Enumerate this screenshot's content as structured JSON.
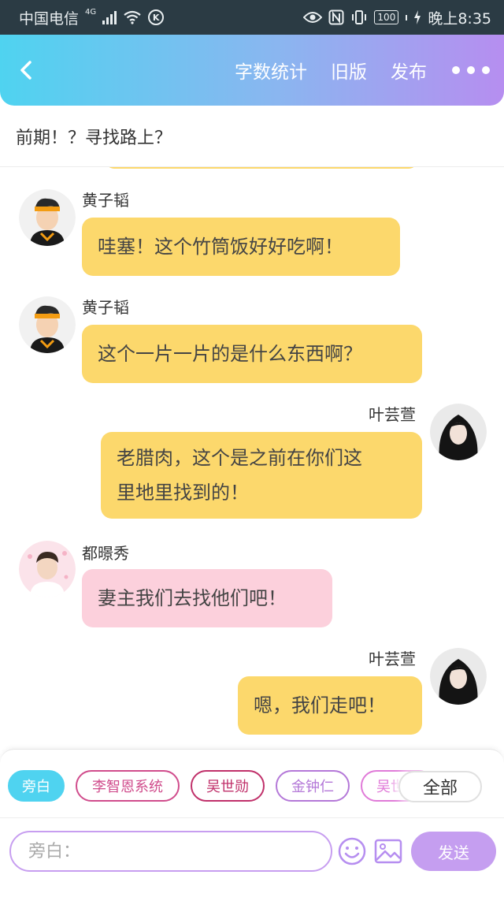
{
  "status_bar": {
    "carrier": "中国电信",
    "network_type": "4G",
    "battery_level": "100",
    "time": "晚上8:35"
  },
  "header": {
    "back_icon": "chevron-left-icon",
    "word_count_label": "字数统计",
    "old_version_label": "旧版",
    "publish_label": "发布",
    "more_icon": "more-dots-icon",
    "colors": {
      "start": "#4fd3f0",
      "end": "#b68ef0"
    }
  },
  "chapter_title": "前期！？寻找路上？",
  "messages": [
    {
      "sender": "黄子韬",
      "text": "哇塞！这个竹筒饭好好吃啊！",
      "side": "left",
      "color": "#fcd86c"
    },
    {
      "sender": "黄子韬",
      "text": "这个一片一片的是什么东西啊？",
      "side": "left",
      "color": "#fcd86c"
    },
    {
      "sender": "叶芸萱",
      "text_line1": "老腊肉，这个是之前在你们这",
      "text_line2": "里地里找到的！",
      "side": "right",
      "color": "#fcd86c"
    },
    {
      "sender": "都暻秀",
      "text": "妻主我们去找他们吧！",
      "side": "left",
      "color": "#fcd0dc"
    },
    {
      "sender": "叶芸萱",
      "text": "嗯，我们走吧！",
      "side": "right",
      "color": "#fcd86c"
    }
  ],
  "character_chips": [
    {
      "label": "旁白",
      "active": true
    },
    {
      "label": "李智恩系统",
      "color": "#d04c8c"
    },
    {
      "label": "吴世勋",
      "color": "#c0306a"
    },
    {
      "label": "金钟仁",
      "color": "#b478d8"
    },
    {
      "label": "吴世",
      "color": "#e07ad8"
    }
  ],
  "all_chip_label": "全部",
  "input": {
    "placeholder": "旁白："
  },
  "send_label": "发送",
  "icons": {
    "emoji": "smiley-icon",
    "image": "image-icon"
  }
}
